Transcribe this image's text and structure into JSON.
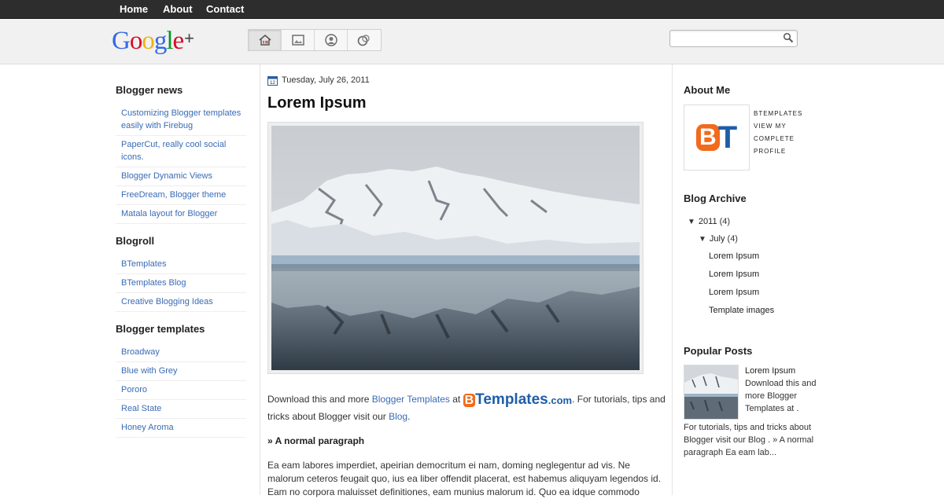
{
  "nav": {
    "home": "Home",
    "about": "About",
    "contact": "Contact"
  },
  "logo": {
    "text_g": "G",
    "text_o1": "o",
    "text_o2": "o",
    "text_g2": "g",
    "text_l": "l",
    "text_e": "e",
    "plus": "+"
  },
  "toolbar": {
    "icons": [
      "home-icon",
      "image-icon",
      "profile-icon",
      "circles-icon"
    ]
  },
  "search": {
    "placeholder": "",
    "value": ""
  },
  "left_sidebar": {
    "blogger_news": {
      "title": "Blogger news",
      "items": [
        "Customizing Blogger templates easily with Firebug",
        "PaperCut, really cool social icons.",
        "Blogger Dynamic Views",
        "FreeDream, Blogger theme",
        "Matala layout for Blogger"
      ]
    },
    "blogroll": {
      "title": "Blogroll",
      "items": [
        "BTemplates",
        "BTemplates Blog",
        "Creative Blogging Ideas"
      ]
    },
    "blogger_templates": {
      "title": "Blogger templates",
      "items": [
        "Broadway",
        "Blue with Grey",
        "Pororo",
        "Real State",
        "Honey Aroma"
      ]
    }
  },
  "post": {
    "date": "Tuesday, July 26, 2011",
    "title": "Lorem Ipsum",
    "text_prefix": "Download this and more ",
    "link_templates": "Blogger Templates",
    "text_at": " at ",
    "bt_logo_b": "B",
    "bt_logo_rest": "Templates",
    "bt_logo_com": ".com",
    "text_suffix": ". For tutorials, tips and tricks about Blogger visit our ",
    "link_blog": "Blog",
    "text_end": ".",
    "subheading": "» A normal paragraph",
    "paragraph": "Ea eam labores imperdiet, apeirian democritum ei nam, doming neglegentur ad vis. Ne malorum ceteros feugait quo, ius ea liber offendit placerat, est habemus aliquyam legendos id. Eam no corpora maluisset definitiones, eam munius malorum id. Quo ea idque commodo"
  },
  "right_sidebar": {
    "about": {
      "title": "About Me",
      "name": "BTEMPLATES",
      "view1": "VIEW MY",
      "view2": "COMPLETE",
      "view3": "PROFILE",
      "logo_b": "B",
      "logo_t": "T"
    },
    "archive": {
      "title": "Blog Archive",
      "year": "2011",
      "year_count": "(4)",
      "year_toggle": "▼",
      "month": "July",
      "month_count": "(4)",
      "month_toggle": "▼",
      "posts": [
        "Lorem Ipsum",
        "Lorem Ipsum",
        "Lorem Ipsum",
        "Template images"
      ]
    },
    "popular": {
      "title": "Popular Posts",
      "post_title": "Lorem Ipsum",
      "snippet_side": "Download this and more Blogger Templates at .",
      "snippet_below": "For tutorials, tips and tricks about Blogger visit our Blog . » A normal paragraph Ea eam lab..."
    }
  },
  "colors": {
    "link": "#3a6bb5",
    "topbar": "#2d2d2d",
    "header": "#f1f1f1",
    "bt_orange": "#f26a1b",
    "bt_blue": "#1e5ea8"
  }
}
